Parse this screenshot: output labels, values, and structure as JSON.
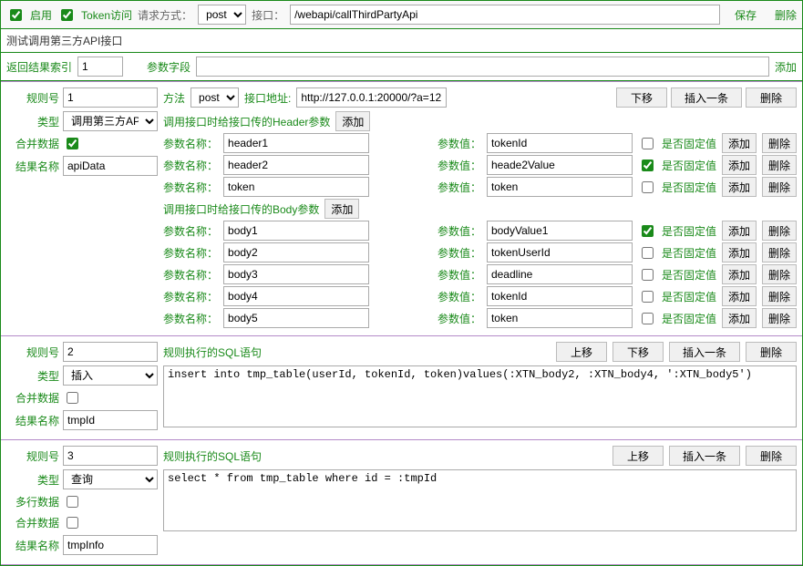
{
  "topbar": {
    "enable_label": "启用",
    "token_label": "Token访问",
    "enable_checked": true,
    "token_checked": true,
    "req_method_label": "请求方式：",
    "req_method_value": "post",
    "iface_label": "接口：",
    "iface_value": "/webapi/callThirdPartyApi",
    "save_label": "保存",
    "delete_label": "删除"
  },
  "title": "测试调用第三方API接口",
  "result_row": {
    "index_label": "返回结果索引",
    "index_value": "1",
    "param_field_label": "参数字段",
    "param_field_value": "",
    "add_label": "添加"
  },
  "labels": {
    "rule_no": "规则号",
    "type": "类型",
    "merge": "合并数据",
    "multiline": "多行数据",
    "result_name": "结果名称",
    "method": "方法",
    "iface_addr": "接口地址:",
    "header_section": "调用接口时给接口传的Header参数",
    "body_section": "调用接口时给接口传的Body参数",
    "sql_section": "规则执行的SQL语句",
    "param_name": "参数名称：",
    "param_value": "参数值：",
    "fixed_value": "是否固定值",
    "add": "添加",
    "delete": "删除",
    "move_up": "上移",
    "move_down": "下移",
    "insert": "插入一条"
  },
  "rule1": {
    "no": "1",
    "type": "调用第三方API",
    "merge_checked": true,
    "result_name": "apiData",
    "method": "post",
    "addr": "http://127.0.0.1:20000/?a=12",
    "headers": [
      {
        "name": "header1",
        "value": "tokenId",
        "fixed": false
      },
      {
        "name": "header2",
        "value": "heade2Value",
        "fixed": true
      },
      {
        "name": "token",
        "value": "token",
        "fixed": false
      }
    ],
    "body": [
      {
        "name": "body1",
        "value": "bodyValue1",
        "fixed": true
      },
      {
        "name": "body2",
        "value": "tokenUserId",
        "fixed": false
      },
      {
        "name": "body3",
        "value": "deadline",
        "fixed": false
      },
      {
        "name": "body4",
        "value": "tokenId",
        "fixed": false
      },
      {
        "name": "body5",
        "value": "token",
        "fixed": false
      }
    ]
  },
  "rule2": {
    "no": "2",
    "type": "插入",
    "merge_checked": false,
    "result_name": "tmpId",
    "sql": "insert into tmp_table(userId, tokenId, token)values(:XTN_body2, :XTN_body4, ':XTN_body5')"
  },
  "rule3": {
    "no": "3",
    "type": "查询",
    "multiline_checked": false,
    "merge_checked": false,
    "result_name": "tmpInfo",
    "sql": "select * from tmp_table where id = :tmpId"
  }
}
